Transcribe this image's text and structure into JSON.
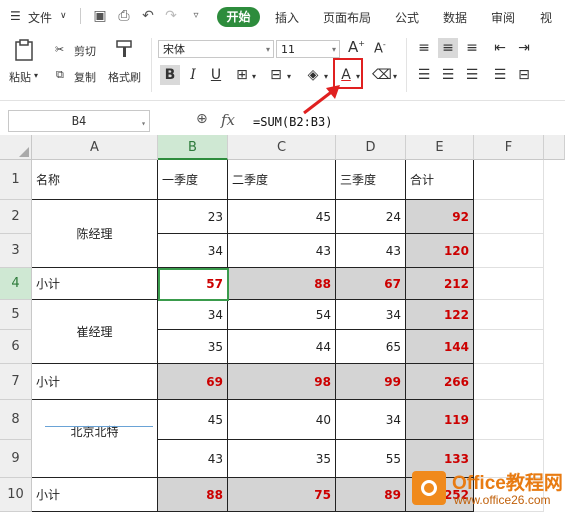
{
  "menubar": {
    "file_label": "文件",
    "tabs": [
      "开始",
      "插入",
      "页面布局",
      "公式",
      "数据",
      "审阅",
      "视"
    ]
  },
  "ribbon": {
    "paste_label": "粘贴",
    "cut_label": "剪切",
    "copy_label": "复制",
    "format_painter_label": "格式刷",
    "font_name": "宋体",
    "font_size": "11",
    "bold": "B",
    "italic": "I",
    "underline": "U",
    "font_color_glyph": "A",
    "highlight_color": "#e02020"
  },
  "formula_bar": {
    "cell_ref": "B4",
    "fx_label": "fx",
    "formula": "=SUM(B2:B3)"
  },
  "sheet": {
    "columns": [
      "A",
      "B",
      "C",
      "D",
      "E",
      "F"
    ],
    "rows": [
      "1",
      "2",
      "3",
      "4",
      "5",
      "6",
      "7",
      "8",
      "9",
      "10"
    ],
    "header": {
      "name": "名称",
      "q1": "一季度",
      "q2": "二季度",
      "q3": "三季度",
      "total": "合计"
    },
    "groups": [
      {
        "name": "陈经理",
        "rows": [
          [
            23,
            45,
            24,
            92
          ],
          [
            34,
            43,
            43,
            120
          ]
        ]
      },
      {
        "name": "崔经理",
        "rows": [
          [
            34,
            54,
            34,
            122
          ],
          [
            35,
            44,
            65,
            144
          ]
        ]
      },
      {
        "name": "北京北特",
        "rows": [
          [
            45,
            40,
            34,
            119
          ],
          [
            43,
            35,
            55,
            133
          ]
        ]
      }
    ],
    "subtotals": [
      {
        "label": "小计",
        "values": [
          57,
          88,
          67,
          212
        ]
      },
      {
        "label": "小计",
        "values": [
          69,
          98,
          99,
          266
        ]
      },
      {
        "label": "小计",
        "values": [
          88,
          75,
          89,
          252
        ]
      }
    ]
  },
  "watermark": {
    "title": "Office教程网",
    "url": "www.office26.com"
  },
  "colors": {
    "accent_green": "#2d8c3c",
    "total_red": "#cc0000",
    "gray_fill": "#d4d4d4"
  }
}
